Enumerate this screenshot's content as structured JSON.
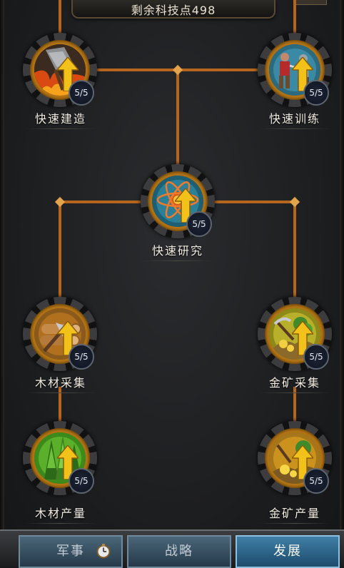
{
  "header": {
    "remaining_points_label": "剩余科技点498"
  },
  "tree": {
    "nodes": [
      {
        "id": "fast-build",
        "label": "快速建造",
        "level": "5/5",
        "icon": "burning-building-icon"
      },
      {
        "id": "fast-train",
        "label": "快速训练",
        "level": "5/5",
        "icon": "soldiers-icon"
      },
      {
        "id": "fast-research",
        "label": "快速研究",
        "level": "5/5",
        "icon": "atom-icon"
      },
      {
        "id": "wood-gather",
        "label": "木材采集",
        "level": "5/5",
        "icon": "wood-axe-icon"
      },
      {
        "id": "gold-gather",
        "label": "金矿采集",
        "level": "5/5",
        "icon": "gold-mine-icon"
      },
      {
        "id": "wood-output",
        "label": "木材产量",
        "level": "5/5",
        "icon": "forest-icon"
      },
      {
        "id": "gold-output",
        "label": "金矿产量",
        "level": "5/5",
        "icon": "gold-nugget-icon"
      }
    ]
  },
  "tabs": [
    {
      "label": "军事",
      "icon": "stopwatch-icon",
      "active": false
    },
    {
      "label": "战略",
      "active": false
    },
    {
      "label": "发展",
      "active": true
    }
  ],
  "colors": {
    "connector": "#b5651c",
    "active_tab": "#3f7fa7",
    "upgrade_arrow": "#f2c21a"
  }
}
